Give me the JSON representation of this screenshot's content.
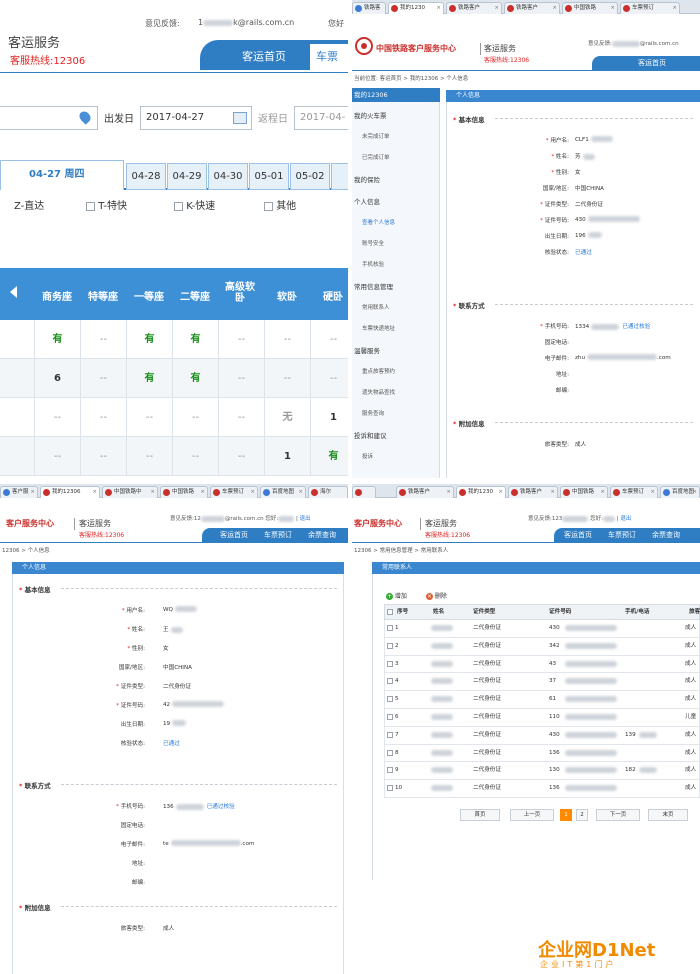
{
  "p1": {
    "feedback": "意见反馈:",
    "feedback_email_suffix": "k@rails.com.cn",
    "feedback_email_prefix": "1",
    "greeting": "您好",
    "brand": "客运服务",
    "hotline": "客服热线:12306",
    "nav": [
      "客运首页",
      "车票"
    ],
    "depart_label": "出发日",
    "depart_date": "2017-04-27",
    "return_label": "返程日",
    "return_date": "2017-04-",
    "dates": [
      "04-27 周四",
      "04-28",
      "04-29",
      "04-30",
      "05-01",
      "05-02"
    ],
    "train_types": [
      "Z-直达",
      "T-特快",
      "K-快速",
      "其他"
    ],
    "columns": [
      "商务座",
      "特等座",
      "一等座",
      "二等座",
      "高级软卧",
      "软卧",
      "硬卧"
    ],
    "rows": [
      [
        "有",
        "--",
        "有",
        "有",
        "--",
        "--",
        "--"
      ],
      [
        "6",
        "--",
        "有",
        "有",
        "--",
        "--",
        "--"
      ],
      [
        "--",
        "--",
        "--",
        "--",
        "--",
        "无",
        "1"
      ],
      [
        "--",
        "--",
        "--",
        "--",
        "--",
        "1",
        "有"
      ]
    ]
  },
  "p2": {
    "tabs": [
      "铁路客户",
      "我的1230",
      "铁路客户",
      "铁路客户",
      "中国铁路",
      "车票预订"
    ],
    "center_name": "中国铁路客户服务中心",
    "brand": "客运服务",
    "hotline": "客服热线:12306",
    "feedback": "意见反馈:",
    "feedback_email_suffix": "@rails.com.cn",
    "nav": [
      "客运首页"
    ],
    "breadcrumb": "当前位置: 客运首页 > 我的12306 > 个人信息",
    "sidebar_title": "我的12306",
    "sidebar": [
      {
        "type": "grp",
        "label": "我的火车票"
      },
      {
        "type": "sub",
        "label": "未完成订单"
      },
      {
        "type": "sub",
        "label": "已完成订单"
      },
      {
        "type": "grp",
        "label": "我的保险"
      },
      {
        "type": "grp",
        "label": "个人信息"
      },
      {
        "type": "sub",
        "label": "查看个人信息",
        "on": true
      },
      {
        "type": "sub",
        "label": "账号安全"
      },
      {
        "type": "sub",
        "label": "手机核验"
      },
      {
        "type": "grp",
        "label": "常用信息管理"
      },
      {
        "type": "sub",
        "label": "常用联系人"
      },
      {
        "type": "sub",
        "label": "车票快递地址"
      },
      {
        "type": "grp",
        "label": "温馨服务"
      },
      {
        "type": "sub",
        "label": "重点旅客预约"
      },
      {
        "type": "sub",
        "label": "遗失物品查找"
      },
      {
        "type": "sub",
        "label": "服务查询"
      },
      {
        "type": "grp",
        "label": "投诉和建议"
      },
      {
        "type": "sub",
        "label": "投诉"
      }
    ],
    "section": "个人信息",
    "basic_title": "基本信息",
    "contact_title": "联系方式",
    "extra_title": "附加信息",
    "fields": {
      "username": {
        "label": "用户名:",
        "value": "CLF1"
      },
      "name": {
        "label": "姓名:",
        "value": "芳"
      },
      "gender": {
        "label": "性别:",
        "value": "女"
      },
      "country": {
        "label": "国家/地区:",
        "value": "中国CHINA"
      },
      "id_type": {
        "label": "证件类型:",
        "value": "二代身份证"
      },
      "id_no": {
        "label": "证件号码:",
        "value": "430"
      },
      "birth": {
        "label": "出生日期:",
        "value": "196"
      },
      "verify": {
        "label": "核验状态:",
        "value": "已通过"
      },
      "phone": {
        "label": "手机号码:",
        "value": "1334",
        "status": "已通过核验"
      },
      "tel": {
        "label": "固定电话:",
        "value": ""
      },
      "email": {
        "label": "电子邮件:",
        "value": "zhu",
        "suffix": ".com"
      },
      "addr": {
        "label": "地址:",
        "value": ""
      },
      "zip": {
        "label": "邮编:",
        "value": ""
      },
      "ptype": {
        "label": "旅客类型:",
        "value": "成人"
      }
    }
  },
  "p3": {
    "tabs": [
      "客户服",
      "我的12306",
      "中国铁路中",
      "中国铁路",
      "车票预订",
      "百度地图",
      "海尔"
    ],
    "center_name": "客户服务中心",
    "brand": "客运服务",
    "hotline": "客服热线:12306",
    "feedback": "意见反馈:",
    "feedback_email": "12",
    "feedback_email_suffix": "@rails.com.cn",
    "greeting": "您好",
    "logout": "退出",
    "nav": [
      "客运首页",
      "车票预订",
      "余票查询"
    ],
    "breadcrumb": "12306 > 个人信息",
    "section": "个人信息",
    "basic_title": "基本信息",
    "contact_title": "联系方式",
    "extra_title": "附加信息",
    "fields": {
      "username": {
        "label": "用户名:",
        "value": "WQ"
      },
      "name": {
        "label": "姓名:",
        "value": "王"
      },
      "gender": {
        "label": "性别:",
        "value": "女"
      },
      "country": {
        "label": "国家/地区:",
        "value": "中国CHINA"
      },
      "id_type": {
        "label": "证件类型:",
        "value": "二代身份证"
      },
      "id_no": {
        "label": "证件号码:",
        "value": "42"
      },
      "birth": {
        "label": "出生日期:",
        "value": "19"
      },
      "verify": {
        "label": "核验状态:",
        "value": "已通过"
      },
      "phone": {
        "label": "手机号码:",
        "value": "136",
        "status": "已通过核验"
      },
      "tel": {
        "label": "固定电话:",
        "value": ""
      },
      "email": {
        "label": "电子邮件:",
        "value": "te",
        "suffix": ".com"
      },
      "addr": {
        "label": "地址:",
        "value": ""
      },
      "zip": {
        "label": "邮编:",
        "value": ""
      },
      "ptype": {
        "label": "旅客类型:",
        "value": "成人"
      }
    }
  },
  "p4": {
    "tabs": [
      "铁路客户",
      "我的1230",
      "铁路客户",
      "中国铁路",
      "车票预订",
      "百度地图"
    ],
    "center_name": "客户服务中心",
    "brand": "客运服务",
    "hotline": "客服热线:12306",
    "feedback": "意见反馈:",
    "feedback_email": "123",
    "greeting": "您好",
    "logout": "退出",
    "nav": [
      "客运首页",
      "车票预订",
      "余票查询"
    ],
    "breadcrumb": "12306 > 常用信息管理 > 常用联系人",
    "section": "常用联系人",
    "add": "增加",
    "del": "删除",
    "columns": [
      "序号",
      "姓名",
      "证件类型",
      "证件号码",
      "手机/电话",
      "旅客类型"
    ],
    "rows": [
      {
        "n": "1",
        "name": "",
        "type": "二代身份证",
        "id": "430",
        "phone": "",
        "ptype": "成人"
      },
      {
        "n": "2",
        "name": "",
        "type": "二代身份证",
        "id": "342",
        "phone": "",
        "ptype": "成人"
      },
      {
        "n": "3",
        "name": "",
        "type": "二代身份证",
        "id": "43",
        "phone": "",
        "ptype": "成人"
      },
      {
        "n": "4",
        "name": "",
        "type": "二代身份证",
        "id": "37",
        "phone": "",
        "ptype": "成人"
      },
      {
        "n": "5",
        "name": "",
        "type": "二代身份证",
        "id": "61",
        "phone": "",
        "ptype": "成人"
      },
      {
        "n": "6",
        "name": "",
        "type": "二代身份证",
        "id": "110",
        "phone": "",
        "ptype": "儿童"
      },
      {
        "n": "7",
        "name": "",
        "type": "二代身份证",
        "id": "430",
        "phone": "139",
        "ptype": "成人"
      },
      {
        "n": "8",
        "name": "",
        "type": "二代身份证",
        "id": "136",
        "phone": "",
        "ptype": "成人"
      },
      {
        "n": "9",
        "name": "",
        "type": "二代身份证",
        "id": "130",
        "phone": "182",
        "ptype": "成人"
      },
      {
        "n": "10",
        "name": "",
        "type": "二代身份证",
        "id": "136",
        "phone": "",
        "ptype": "成人"
      }
    ],
    "pager": {
      "first": "首页",
      "prev": "上一页",
      "pages": [
        "1",
        "2"
      ],
      "next": "下一页",
      "last": "末页"
    }
  },
  "watermark": {
    "brand": "企业网D1Net",
    "sub": "企业IT第1门户"
  },
  "colors": {
    "accent": "#2f7dc3",
    "available": "#1a8f1a",
    "required": "#e02020",
    "link": "#2a7ad6"
  }
}
